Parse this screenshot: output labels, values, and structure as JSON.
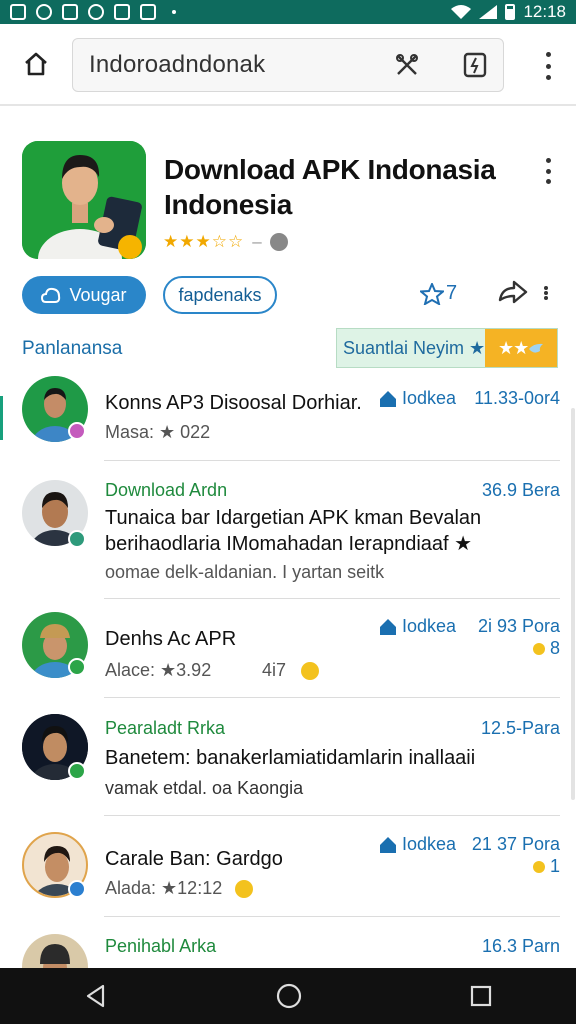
{
  "status_bar": {
    "time": "12:18"
  },
  "browser": {
    "url": "Indoroadndonak"
  },
  "app": {
    "title": "Download APK Indonasia Indonesia",
    "rating_stars": "★★★☆☆",
    "dash": "–",
    "primary_button": "Vougar",
    "secondary_button": "fapdenaks",
    "favorite_count": "7"
  },
  "section": {
    "label": "Panlanansa",
    "badge_text": "Suantlai Neyim ★",
    "badge_stars": "★★"
  },
  "reviews": [
    {
      "name": "Konns AP3 Disoosal Dorhiar.",
      "tag": "Iodkea",
      "time": "11.33-0or4",
      "meta": "Masa: ★ 022"
    },
    {
      "name": "Download Ardn",
      "time": "36.9 Bera",
      "text_line1": "Tunaica bar Idargetian APK kman Bevalan",
      "text_line2": "berihaodlaria IMomahadan Ierapndiaaf ★",
      "meta": "oomae delk-aldanian. I yartan seitk"
    },
    {
      "name": "Denhs Ac APR",
      "tag": "Iodkea",
      "time": "2i 93 Pora",
      "time2": "8",
      "meta": "Alace: ★3.92",
      "meta_extra": "4i7"
    },
    {
      "name": "Pearaladt Rrka",
      "time": "12.5-Para",
      "text_line1": "Banetem: banakerlamiatidamlarin inallaaii",
      "meta": "vamak etdal. oa Kaongia"
    },
    {
      "name": "Carale Ban: Gardgo",
      "tag": "Iodkea",
      "time": "21 37 Pora",
      "time2": "1",
      "meta": "Alada: ★12:12"
    },
    {
      "name": "Penihabl Arka",
      "time": "16.3 Parn"
    }
  ],
  "icons": {
    "home": "home-icon",
    "tools": "tools-icon",
    "tabs": "tab-switcher-icon",
    "share": "share-icon",
    "star": "star-icon"
  },
  "colors": {
    "status_bar": "#0e6b5e",
    "accent_blue": "#2a86c9",
    "accent_green": "#1f8a3d",
    "star": "#f1a800"
  }
}
